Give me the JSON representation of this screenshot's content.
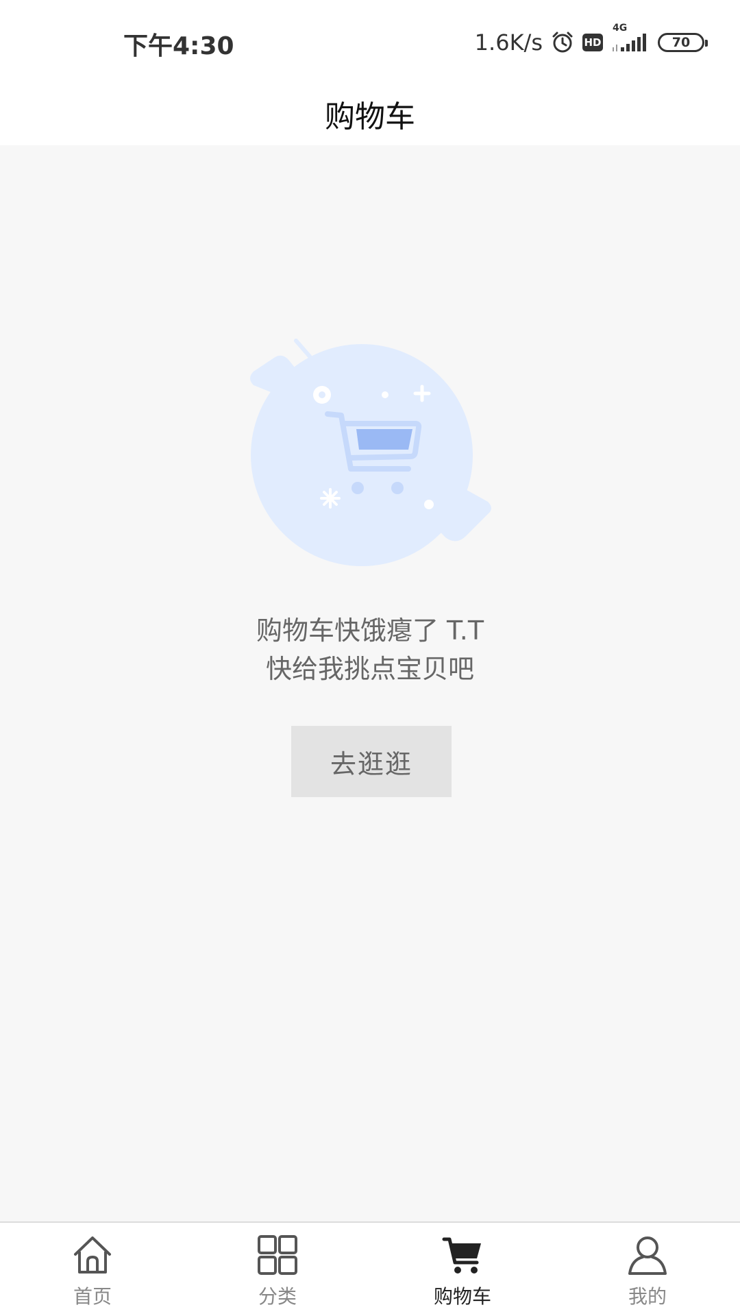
{
  "status_bar": {
    "time": "下午4:30",
    "network_speed": "1.6K/s",
    "alarm_icon": "alarm-clock-icon",
    "hd_label": "HD",
    "network_type": "4G",
    "signal_icon": "signal-bars-icon",
    "battery_level": "70"
  },
  "header": {
    "title": "购物车"
  },
  "empty_state": {
    "illustration_icon": "empty-cart-icon",
    "message_line1": "购物车快饿瘪了 T.T",
    "message_line2": "快给我挑点宝贝吧",
    "button_label": "去逛逛"
  },
  "tab_bar": {
    "items": [
      {
        "label": "首页",
        "icon": "home-icon",
        "active": false
      },
      {
        "label": "分类",
        "icon": "grid-icon",
        "active": false
      },
      {
        "label": "购物车",
        "icon": "cart-icon",
        "active": true
      },
      {
        "label": "我的",
        "icon": "user-icon",
        "active": false
      }
    ]
  },
  "colors": {
    "page_background": "#f7f7f7",
    "illustration_circle": "#e1ecfe",
    "illustration_cart": "#9ab9f4",
    "button_background": "#e3e3e3",
    "active_tab": "#222222",
    "inactive_tab": "#888888"
  }
}
